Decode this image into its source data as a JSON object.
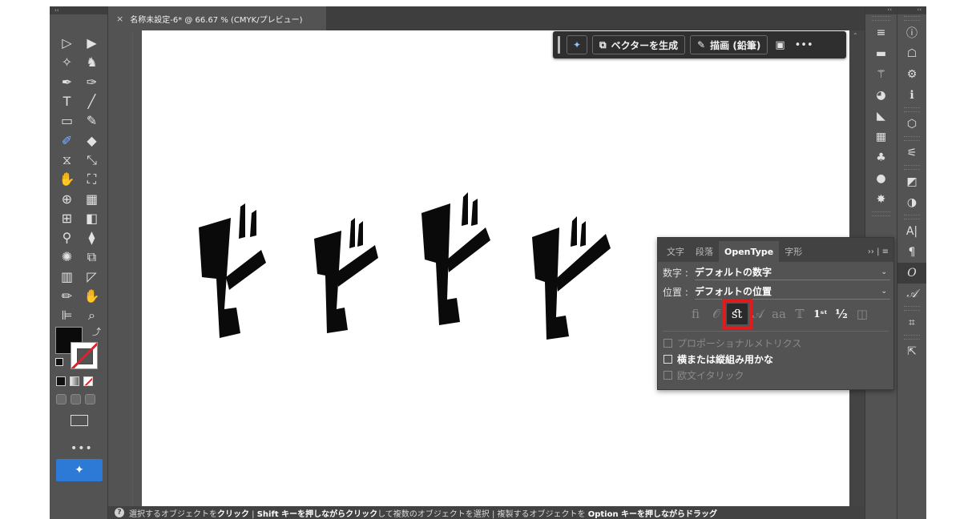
{
  "document_tab": {
    "close": "×",
    "title": "名称未設定-6* @ 66.67 % (CMYK/プレビュー)"
  },
  "toolbar": {
    "collapse": "‹‹",
    "tools": [
      [
        "selection-tool",
        "direct-selection-tool"
      ],
      [
        "magic-wand-tool",
        "lasso-tool"
      ],
      [
        "pen-tool",
        "curvature-tool"
      ],
      [
        "type-tool",
        "line-segment-tool"
      ],
      [
        "rectangle-tool",
        "paintbrush-tool"
      ],
      [
        "shaper-tool",
        "eraser-tool"
      ],
      [
        "reflect-tool",
        "scale-tool"
      ],
      [
        "puppet-warp-tool",
        "free-transform-tool"
      ],
      [
        "shape-builder-tool",
        "perspective-grid-tool"
      ],
      [
        "mesh-tool",
        "gradient-tool"
      ],
      [
        "eyedropper-tool",
        "blend-tool"
      ],
      [
        "symbol-sprayer-tool",
        "artboard-tool"
      ],
      [
        "column-graph-tool",
        "slice-tool"
      ],
      [
        "pencil-tool",
        "hand-tool"
      ],
      [
        "eraser-2-tool",
        "zoom-tool"
      ]
    ],
    "more": "•••",
    "generate_icon": "✦"
  },
  "context_taskbar": {
    "generate_vector": "ベクターを生成",
    "draw_pencil": "描画 (鉛筆)",
    "more": "•••"
  },
  "statusbar": {
    "help": "?",
    "segments": [
      {
        "text": "選択するオブジェクトを",
        "bold": false
      },
      {
        "text": "クリック",
        "bold": true
      },
      {
        "text": " | ",
        "bold": false
      },
      {
        "text": "Shift キーを押しながらクリック",
        "bold": true
      },
      {
        "text": "して複数のオブジェクトを選択 | 複製するオブジェクトを ",
        "bold": false
      },
      {
        "text": "Option キーを押しながらドラッグ",
        "bold": true
      }
    ]
  },
  "opentype_panel": {
    "tabs": [
      "文字",
      "段落",
      "OpenType",
      "字形"
    ],
    "active_tab": "OpenType",
    "menu": "›› | ≡",
    "number_label": "数字 :",
    "number_value": "デフォルトの数字",
    "position_label": "位置 :",
    "position_value": "デフォルトの位置",
    "glyph_buttons": [
      {
        "glyph": "ﬁ",
        "name": "standard-ligatures-button",
        "state": "off"
      },
      {
        "glyph": "𝒪",
        "name": "contextual-alternates-button",
        "state": "off"
      },
      {
        "glyph": "ﬆ",
        "name": "discretionary-ligatures-button",
        "state": "selected"
      },
      {
        "glyph": "𝒜",
        "name": "swash-button",
        "state": "off"
      },
      {
        "glyph": "aa",
        "name": "stylistic-alternates-button",
        "state": "off"
      },
      {
        "glyph": "𝕋",
        "name": "titling-alternates-button",
        "state": "off"
      },
      {
        "glyph": "1ˢᵗ",
        "name": "ordinals-button",
        "state": "on"
      },
      {
        "glyph": "½",
        "name": "fractions-button",
        "state": "on"
      },
      {
        "glyph": "◫",
        "name": "stylistic-sets-button",
        "state": "off"
      }
    ],
    "options": [
      {
        "label": "プロポーショナルメトリクス",
        "enabled": false
      },
      {
        "label": "横または縦組み用かな",
        "enabled": true
      },
      {
        "label": "欧文イタリック",
        "enabled": false
      }
    ]
  },
  "dock1": {
    "collapse": "‹‹",
    "icons": [
      "properties-icon",
      "stroke-icon",
      "brushes-icon",
      "color-guide-icon",
      "transparency-icon",
      "swatches-icon",
      "symbols-icon",
      "appearance-icon",
      "graphic-styles-icon",
      "layers-icon"
    ]
  },
  "dock2": {
    "collapse": "‹‹",
    "icons": [
      "document-info-icon",
      "library-icon",
      "gear-icon",
      "info-icon",
      "3d-icon",
      "adjust-icon",
      "artboards-icon",
      "color-icon",
      "character-icon",
      "paragraph-icon",
      "opentype-icon",
      "glyphs-icon",
      "align-icon",
      "export-icon"
    ]
  },
  "artwork": {
    "description_text": "ドドドド"
  }
}
